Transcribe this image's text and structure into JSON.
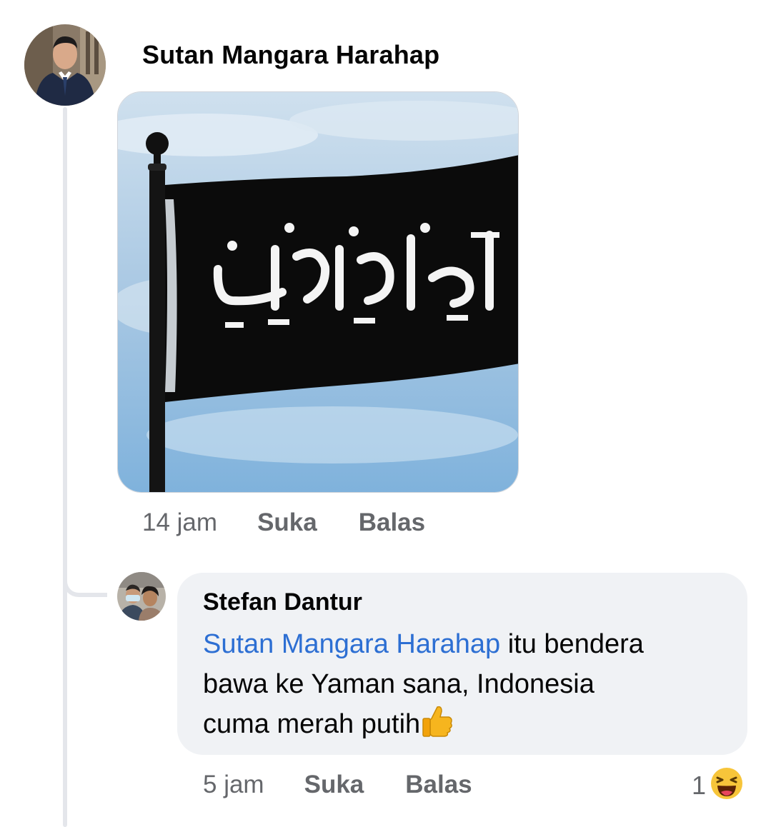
{
  "comment": {
    "author": "Sutan Mangara Harahap",
    "avatar_icon": "profile-photo-man-in-suit",
    "image_icon": "black-flag-with-arabic-script-image",
    "time": "14 jam",
    "like_label": "Suka",
    "reply_label": "Balas"
  },
  "reply": {
    "author": "Stefan Dantur",
    "avatar_icon": "profile-photo-two-people",
    "mention": "Sutan Mangara Harahap",
    "text_line1_rest": " itu bendera",
    "text_line2": "bawa ke Yaman sana, Indonesia",
    "text_line3": "cuma merah putih",
    "emoji_icon": "thumbs-up-emoji",
    "time": "5 jam",
    "like_label": "Suka",
    "reply_label": "Balas",
    "reaction_count": "1",
    "reaction_icon": "laughing-emoji"
  },
  "colors": {
    "link": "#2d6fd3",
    "muted": "#65676b",
    "bubble": "#f0f2f5",
    "thread_line": "#e4e6eb"
  }
}
